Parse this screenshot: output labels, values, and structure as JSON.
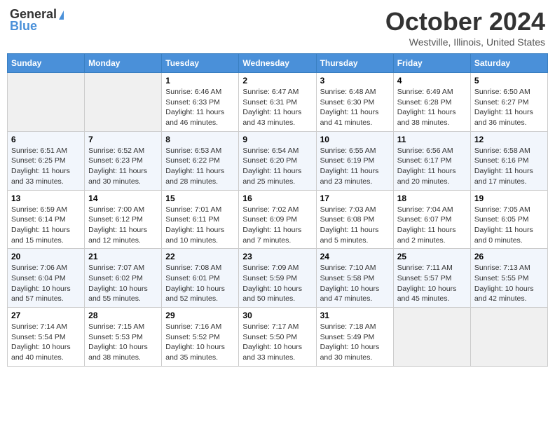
{
  "header": {
    "logo_general": "General",
    "logo_blue": "Blue",
    "month": "October 2024",
    "location": "Westville, Illinois, United States"
  },
  "days_of_week": [
    "Sunday",
    "Monday",
    "Tuesday",
    "Wednesday",
    "Thursday",
    "Friday",
    "Saturday"
  ],
  "weeks": [
    [
      {
        "day": "",
        "empty": true
      },
      {
        "day": "",
        "empty": true
      },
      {
        "day": "1",
        "sunrise": "6:46 AM",
        "sunset": "6:33 PM",
        "daylight": "11 hours and 46 minutes."
      },
      {
        "day": "2",
        "sunrise": "6:47 AM",
        "sunset": "6:31 PM",
        "daylight": "11 hours and 43 minutes."
      },
      {
        "day": "3",
        "sunrise": "6:48 AM",
        "sunset": "6:30 PM",
        "daylight": "11 hours and 41 minutes."
      },
      {
        "day": "4",
        "sunrise": "6:49 AM",
        "sunset": "6:28 PM",
        "daylight": "11 hours and 38 minutes."
      },
      {
        "day": "5",
        "sunrise": "6:50 AM",
        "sunset": "6:27 PM",
        "daylight": "11 hours and 36 minutes."
      }
    ],
    [
      {
        "day": "6",
        "sunrise": "6:51 AM",
        "sunset": "6:25 PM",
        "daylight": "11 hours and 33 minutes."
      },
      {
        "day": "7",
        "sunrise": "6:52 AM",
        "sunset": "6:23 PM",
        "daylight": "11 hours and 30 minutes."
      },
      {
        "day": "8",
        "sunrise": "6:53 AM",
        "sunset": "6:22 PM",
        "daylight": "11 hours and 28 minutes."
      },
      {
        "day": "9",
        "sunrise": "6:54 AM",
        "sunset": "6:20 PM",
        "daylight": "11 hours and 25 minutes."
      },
      {
        "day": "10",
        "sunrise": "6:55 AM",
        "sunset": "6:19 PM",
        "daylight": "11 hours and 23 minutes."
      },
      {
        "day": "11",
        "sunrise": "6:56 AM",
        "sunset": "6:17 PM",
        "daylight": "11 hours and 20 minutes."
      },
      {
        "day": "12",
        "sunrise": "6:58 AM",
        "sunset": "6:16 PM",
        "daylight": "11 hours and 17 minutes."
      }
    ],
    [
      {
        "day": "13",
        "sunrise": "6:59 AM",
        "sunset": "6:14 PM",
        "daylight": "11 hours and 15 minutes."
      },
      {
        "day": "14",
        "sunrise": "7:00 AM",
        "sunset": "6:12 PM",
        "daylight": "11 hours and 12 minutes."
      },
      {
        "day": "15",
        "sunrise": "7:01 AM",
        "sunset": "6:11 PM",
        "daylight": "11 hours and 10 minutes."
      },
      {
        "day": "16",
        "sunrise": "7:02 AM",
        "sunset": "6:09 PM",
        "daylight": "11 hours and 7 minutes."
      },
      {
        "day": "17",
        "sunrise": "7:03 AM",
        "sunset": "6:08 PM",
        "daylight": "11 hours and 5 minutes."
      },
      {
        "day": "18",
        "sunrise": "7:04 AM",
        "sunset": "6:07 PM",
        "daylight": "11 hours and 2 minutes."
      },
      {
        "day": "19",
        "sunrise": "7:05 AM",
        "sunset": "6:05 PM",
        "daylight": "11 hours and 0 minutes."
      }
    ],
    [
      {
        "day": "20",
        "sunrise": "7:06 AM",
        "sunset": "6:04 PM",
        "daylight": "10 hours and 57 minutes."
      },
      {
        "day": "21",
        "sunrise": "7:07 AM",
        "sunset": "6:02 PM",
        "daylight": "10 hours and 55 minutes."
      },
      {
        "day": "22",
        "sunrise": "7:08 AM",
        "sunset": "6:01 PM",
        "daylight": "10 hours and 52 minutes."
      },
      {
        "day": "23",
        "sunrise": "7:09 AM",
        "sunset": "5:59 PM",
        "daylight": "10 hours and 50 minutes."
      },
      {
        "day": "24",
        "sunrise": "7:10 AM",
        "sunset": "5:58 PM",
        "daylight": "10 hours and 47 minutes."
      },
      {
        "day": "25",
        "sunrise": "7:11 AM",
        "sunset": "5:57 PM",
        "daylight": "10 hours and 45 minutes."
      },
      {
        "day": "26",
        "sunrise": "7:13 AM",
        "sunset": "5:55 PM",
        "daylight": "10 hours and 42 minutes."
      }
    ],
    [
      {
        "day": "27",
        "sunrise": "7:14 AM",
        "sunset": "5:54 PM",
        "daylight": "10 hours and 40 minutes."
      },
      {
        "day": "28",
        "sunrise": "7:15 AM",
        "sunset": "5:53 PM",
        "daylight": "10 hours and 38 minutes."
      },
      {
        "day": "29",
        "sunrise": "7:16 AM",
        "sunset": "5:52 PM",
        "daylight": "10 hours and 35 minutes."
      },
      {
        "day": "30",
        "sunrise": "7:17 AM",
        "sunset": "5:50 PM",
        "daylight": "10 hours and 33 minutes."
      },
      {
        "day": "31",
        "sunrise": "7:18 AM",
        "sunset": "5:49 PM",
        "daylight": "10 hours and 30 minutes."
      },
      {
        "day": "",
        "empty": true
      },
      {
        "day": "",
        "empty": true
      }
    ]
  ]
}
